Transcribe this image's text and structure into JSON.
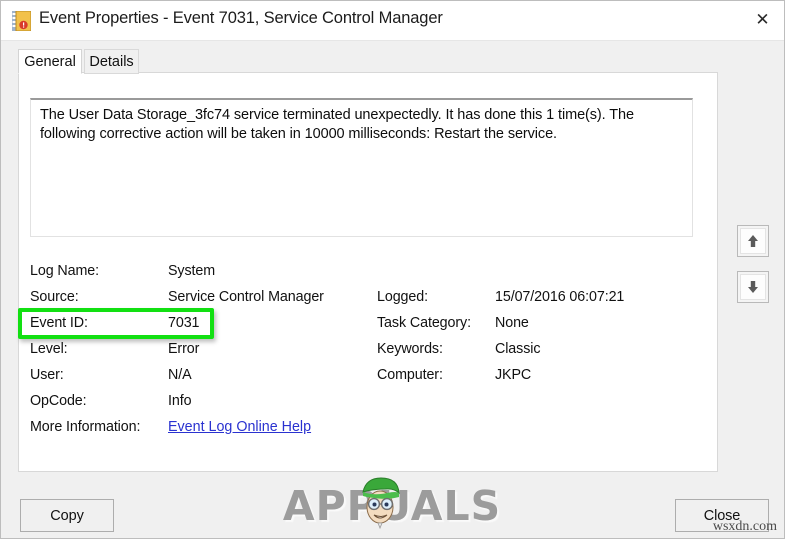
{
  "window": {
    "title": "Event Properties - Event 7031, Service Control Manager",
    "icon": "event-log-book-icon",
    "close_label": "✕"
  },
  "tabs": [
    {
      "label": "General",
      "active": true
    },
    {
      "label": "Details",
      "active": false
    }
  ],
  "message": "The User Data Storage_3fc74 service terminated unexpectedly. It has done this 1 time(s). The following corrective action will be taken in 10000 milliseconds: Restart the service.",
  "details": {
    "left_column": [
      {
        "label": "Log Name:",
        "value": "System"
      },
      {
        "label": "Source:",
        "value": "Service Control Manager"
      },
      {
        "label": "Event ID:",
        "value": "7031"
      },
      {
        "label": "Level:",
        "value": "Error"
      },
      {
        "label": "User:",
        "value": "N/A"
      },
      {
        "label": "OpCode:",
        "value": "Info"
      }
    ],
    "more_information": {
      "label": "More Information:",
      "link_text": "Event Log Online Help"
    },
    "right_column": [
      {
        "label": "Logged:",
        "value": "15/07/2016 06:07:21"
      },
      {
        "label": "Task Category:",
        "value": "None"
      },
      {
        "label": "Keywords:",
        "value": "Classic"
      },
      {
        "label": "Computer:",
        "value": "JKPC"
      }
    ]
  },
  "navigation": {
    "previous_icon": "arrow-up-icon",
    "next_icon": "arrow-down-icon"
  },
  "buttons": {
    "copy": "Copy",
    "close": "Close"
  },
  "highlight": {
    "target": "Event ID:",
    "color": "#12e012"
  },
  "watermarks": {
    "brand": "APPUALS",
    "site": "wsxdn.com"
  }
}
